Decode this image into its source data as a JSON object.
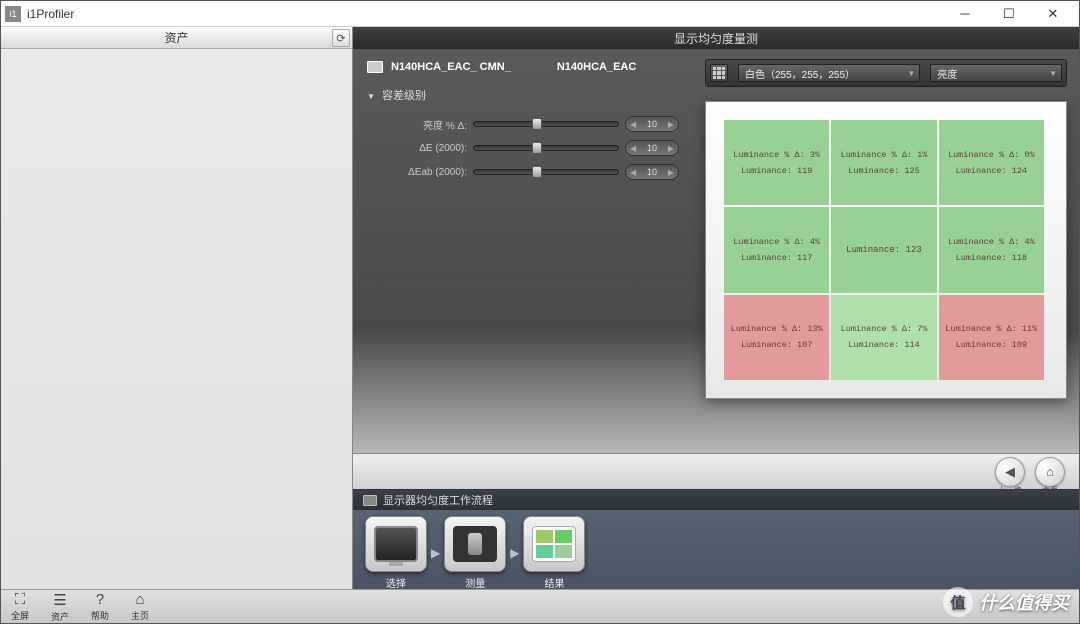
{
  "window": {
    "title": "i1Profiler"
  },
  "sidebar": {
    "header": "资产"
  },
  "main": {
    "header": "显示均匀度量测"
  },
  "device": {
    "name1": "N140HCA_EAC_ CMN_",
    "name2": "N140HCA_EAC"
  },
  "tolerance": {
    "title": "容差级别",
    "rows": [
      {
        "label": "亮度 % Δ:",
        "value": "10"
      },
      {
        "label": "ΔE (2000):",
        "value": "10"
      },
      {
        "label": "ΔEab (2000):",
        "value": "10"
      }
    ]
  },
  "dropdowns": {
    "color": "白色（255，255，255）",
    "metric": "亮度"
  },
  "grid": {
    "cells": [
      {
        "delta": "3%",
        "lum": "119",
        "cls": "green"
      },
      {
        "delta": "1%",
        "lum": "125",
        "cls": "green"
      },
      {
        "delta": "0%",
        "lum": "124",
        "cls": "green"
      },
      {
        "delta": "4%",
        "lum": "117",
        "cls": "green"
      },
      {
        "delta": "",
        "lum": "123",
        "cls": "green",
        "center": true
      },
      {
        "delta": "4%",
        "lum": "118",
        "cls": "green"
      },
      {
        "delta": "13%",
        "lum": "107",
        "cls": "red"
      },
      {
        "delta": "7%",
        "lum": "114",
        "cls": "lightg"
      },
      {
        "delta": "11%",
        "lum": "109",
        "cls": "red"
      }
    ],
    "labels": {
      "delta": "Luminance % Δ:",
      "lum": "Luminance:"
    }
  },
  "nav": {
    "prev": "上一步",
    "home": "主页"
  },
  "workflow": {
    "title": "显示器均匀度工作流程",
    "steps": [
      {
        "label": "选择"
      },
      {
        "label": "测量"
      },
      {
        "label": "结果"
      }
    ]
  },
  "statusbar": {
    "items": [
      {
        "label": "全屏"
      },
      {
        "label": "资产"
      },
      {
        "label": "帮助"
      },
      {
        "label": "主页"
      }
    ]
  },
  "watermark": "什么值得买"
}
